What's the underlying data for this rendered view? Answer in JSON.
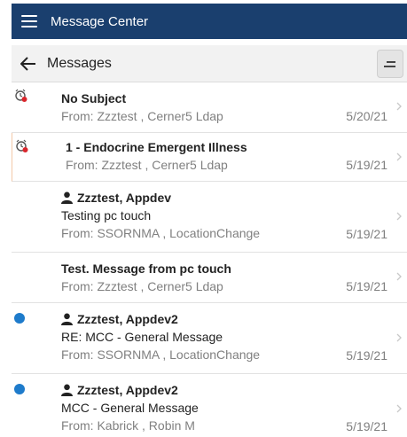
{
  "app_bar": {
    "title": "Message Center",
    "menu_icon": "hamburger-icon"
  },
  "sub_bar": {
    "title": "Messages",
    "back_icon": "arrow-left-icon",
    "filter_icon": "filter-lines-icon"
  },
  "messages": [
    {
      "indicator": "alarm-icon",
      "has_person": false,
      "lines": [
        "No Subject"
      ],
      "from": "From: Zzztest , Cerner5 Ldap",
      "date": "5/20/21"
    },
    {
      "indicator": "alarm-icon",
      "has_person": false,
      "lines": [
        "1 - Endocrine Emergent Illness"
      ],
      "from": "From: Zzztest , Cerner5 Ldap",
      "date": "5/19/21"
    },
    {
      "indicator": "",
      "has_person": true,
      "lines": [
        "Zzztest, Appdev",
        "Testing pc touch"
      ],
      "from": "From: SSORNMA , LocationChange",
      "date": "5/19/21"
    },
    {
      "indicator": "",
      "has_person": false,
      "lines": [
        "Test. Message from pc touch"
      ],
      "from": "From: Zzztest , Cerner5 Ldap",
      "date": "5/19/21"
    },
    {
      "indicator": "unread-dot",
      "has_person": true,
      "lines": [
        "Zzztest, Appdev2",
        "RE: MCC - General Message"
      ],
      "from": "From: SSORNMA , LocationChange",
      "date": "5/19/21"
    },
    {
      "indicator": "unread-dot",
      "has_person": true,
      "lines": [
        "Zzztest, Appdev2",
        "MCC - General Message"
      ],
      "from": "From: Kabrick , Robin M",
      "date": "5/19/21"
    }
  ],
  "colors": {
    "header": "#1a3f6e",
    "unread_dot": "#1e7bcb",
    "alarm_red": "#d9262c"
  }
}
